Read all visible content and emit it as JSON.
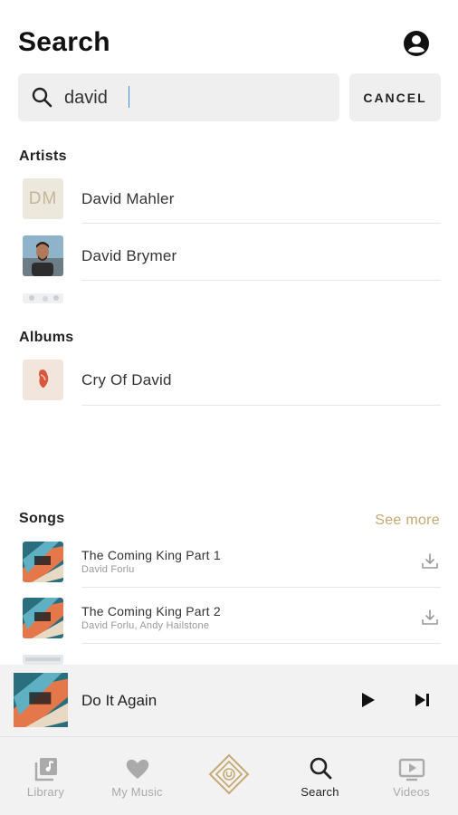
{
  "header": {
    "title": "Search",
    "account_icon": "account-circle-icon"
  },
  "search": {
    "value": "david",
    "cancel_label": "CANCEL",
    "icon": "search-icon"
  },
  "sections": {
    "artists": "Artists",
    "albums": "Albums",
    "songs": "Songs",
    "see_more": "See more"
  },
  "artists": [
    {
      "name": "David Mahler",
      "initials": "DM"
    },
    {
      "name": "David Brymer"
    }
  ],
  "albums": [
    {
      "name": "Cry Of David"
    }
  ],
  "songs": [
    {
      "title": "The Coming King Part 1",
      "artist": "David Forlu"
    },
    {
      "title": "The Coming King Part 2",
      "artist": "David Forlu, Andy Hailstone"
    }
  ],
  "now_playing": {
    "title": "Do It Again"
  },
  "tabs": [
    {
      "label": "Library",
      "icon": "library-icon",
      "active": false
    },
    {
      "label": "My Music",
      "icon": "heart-icon",
      "active": false
    },
    {
      "label": "",
      "icon": "brand-logo-icon",
      "active": false
    },
    {
      "label": "Search",
      "icon": "search-icon",
      "active": true
    },
    {
      "label": "Videos",
      "icon": "video-icon",
      "active": false
    }
  ],
  "colors": {
    "accent": "#c6a972",
    "caret": "#3a8ee8",
    "panel": "#f2f2f2"
  }
}
